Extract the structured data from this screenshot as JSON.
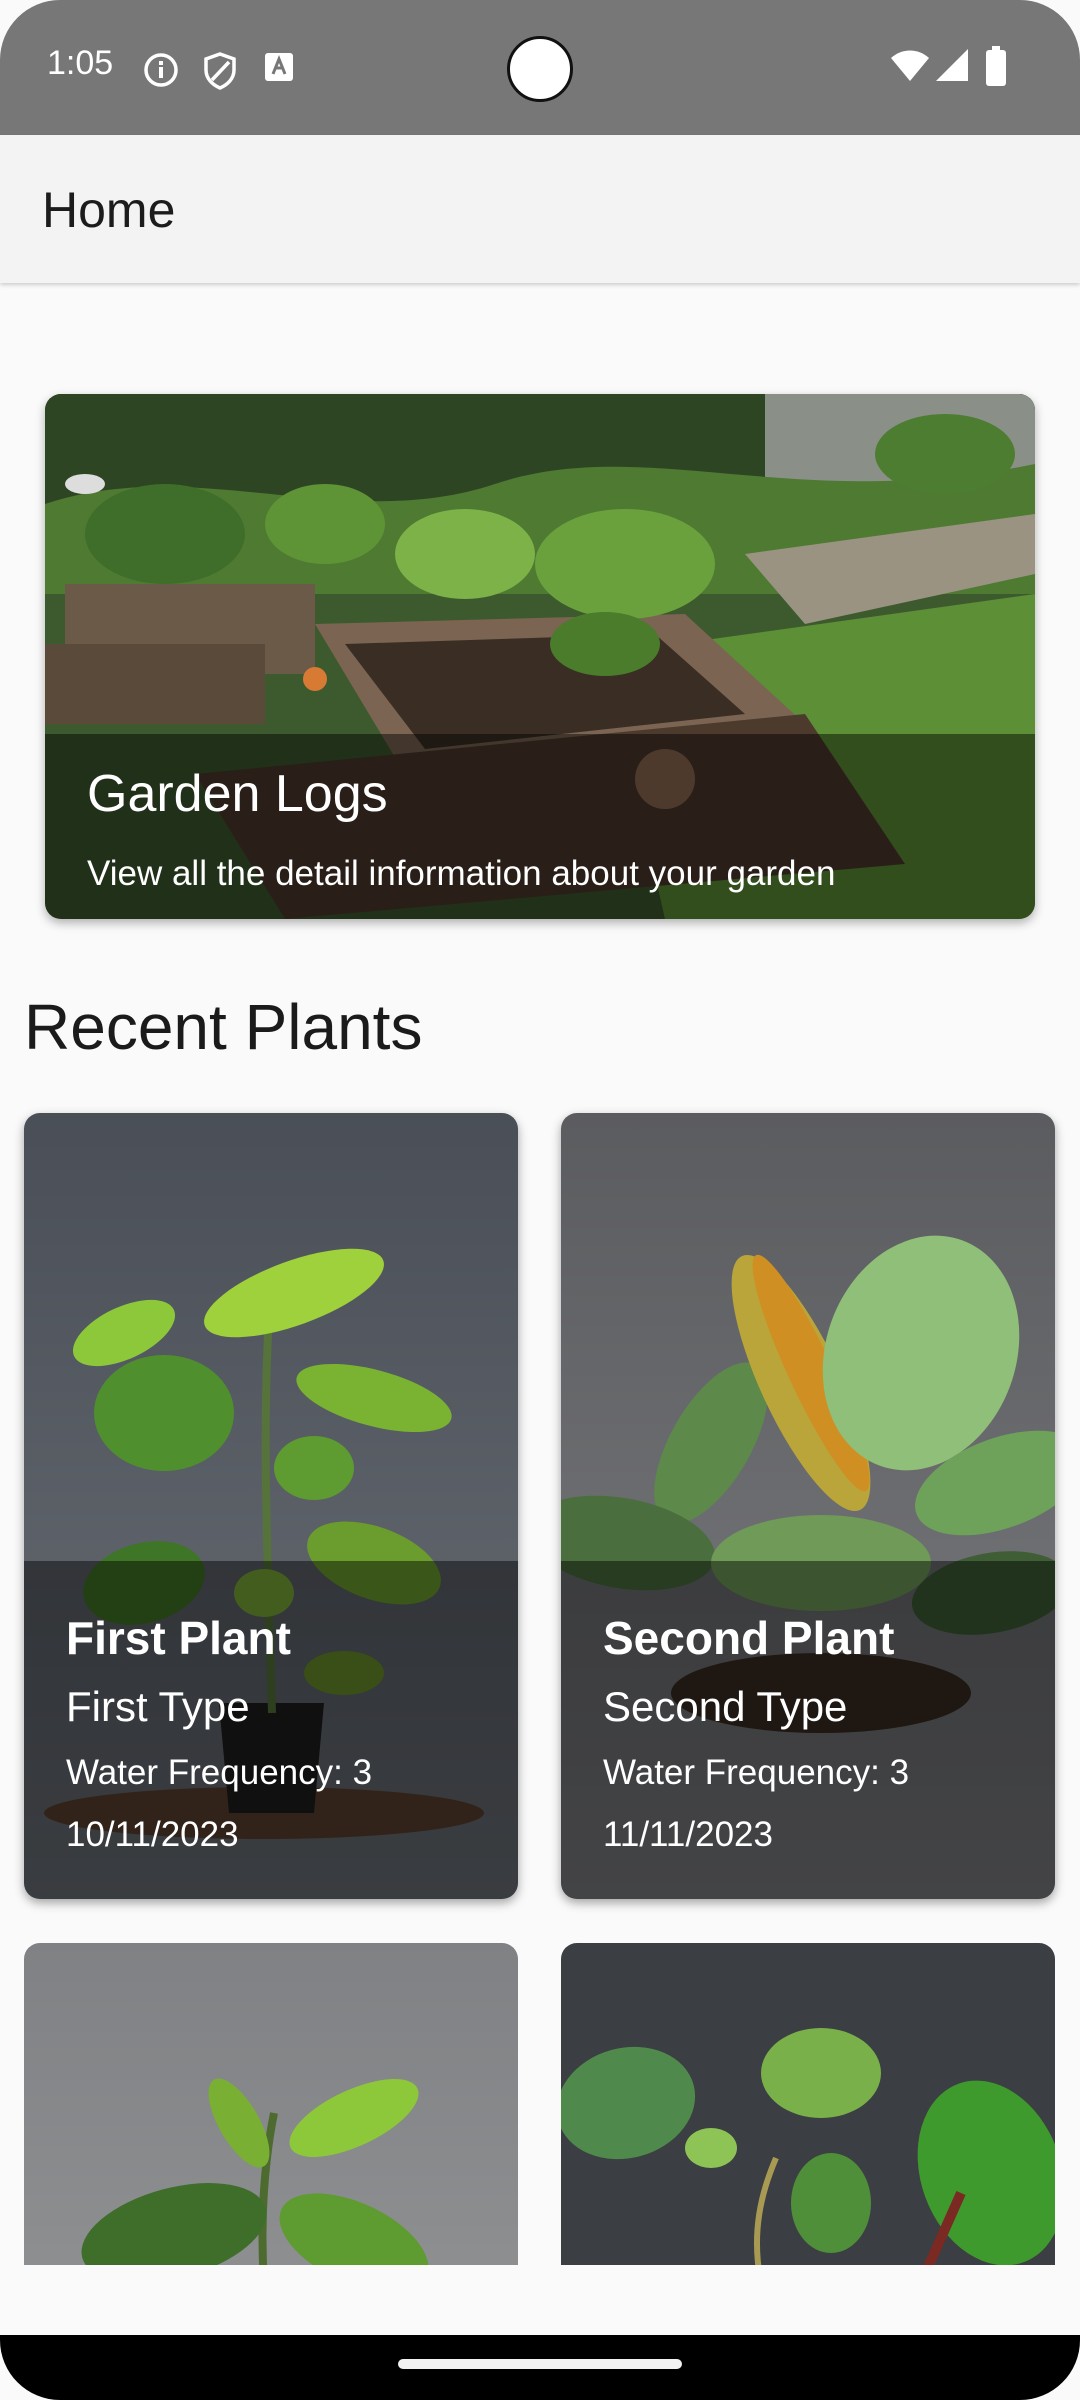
{
  "status_bar": {
    "time": "1:05",
    "left_icons": [
      "info-icon",
      "shield-icon",
      "font-icon"
    ],
    "right_icons": [
      "wifi-icon",
      "signal-icon",
      "battery-icon"
    ]
  },
  "app_bar": {
    "title": "Home"
  },
  "hero_card": {
    "title": "Garden Logs",
    "subtitle": "View all the detail information about your garden"
  },
  "section": {
    "title": "Recent Plants"
  },
  "plants": [
    {
      "name": "First Plant",
      "type": "First Type",
      "water": "Water Frequency: 3",
      "date": "10/11/2023"
    },
    {
      "name": "Second Plant",
      "type": "Second Type",
      "water": "Water Frequency: 3",
      "date": "11/11/2023"
    }
  ],
  "colors": {
    "status_bar": "#777777",
    "app_bar": "#f3f3f3",
    "background": "#fafafa"
  }
}
